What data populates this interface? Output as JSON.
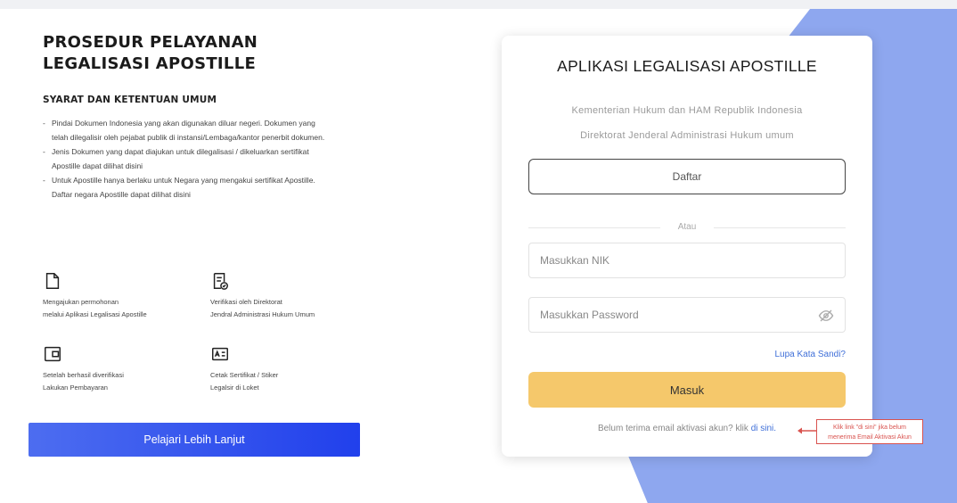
{
  "left": {
    "title_line1": "PROSEDUR PELAYANAN",
    "title_line2": "LEGALISASI APOSTILLE",
    "subtitle": "SYARAT DAN KETENTUAN UMUM",
    "rules": [
      "Pindai Dokumen Indonesia yang akan digunakan diluar negeri. Dokumen yang telah dilegalisir oleh pejabat publik di instansi/Lembaga/kantor penerbit dokumen.",
      "Jenis Dokumen yang dapat diajukan untuk dilegalisasi / dikeluarkan sertifikat Apostille dapat dilihat disini",
      "Untuk Apostille hanya berlaku untuk Negara yang mengakui sertifikat Apostille. Daftar negara Apostille dapat dilihat disini"
    ],
    "steps": [
      {
        "icon": "document-icon",
        "line1": "Mengajukan permohonan",
        "line2": "melalui Aplikasi Legalisasi Apostille"
      },
      {
        "icon": "document-check-icon",
        "line1": "Verifikasi oleh Direktorat",
        "line2": "Jendral Administrasi Hukum Umum"
      },
      {
        "icon": "wallet-icon",
        "line1": "Setelah berhasil diverifikasi",
        "line2": "Lakukan Pembayaran"
      },
      {
        "icon": "id-card-icon",
        "line1": "Cetak Sertifikat / Stiker",
        "line2": "Legalsir di Loket"
      }
    ],
    "learn_more_label": "Pelajari Lebih Lanjut"
  },
  "login": {
    "title": "APLIKASI LEGALISASI APOSTILLE",
    "org_line1": "Kementerian Hukum dan HAM Republik Indonesia",
    "org_line2": "Direktorat Jenderal Administrasi Hukum umum",
    "register_label": "Daftar",
    "divider_label": "Atau",
    "nik_placeholder": "Masukkan NIK",
    "password_placeholder": "Masukkan Password",
    "forgot_label": "Lupa Kata Sandi?",
    "login_label": "Masuk",
    "activation_text": "Belum terima email aktivasi akun? klik ",
    "activation_link": "di sini.",
    "eye_icon": "eye-slash-icon"
  },
  "callout": {
    "line1": "Klik link \"di sini\" jika belum",
    "line2": "menerima Email Aktivasi Akun"
  },
  "colors": {
    "accent_blue": "#2140ec",
    "login_yellow": "#f5c86b",
    "bg_shape": "#8ea7ef",
    "link": "#3f6fd8",
    "callout_red": "#d9534f"
  }
}
